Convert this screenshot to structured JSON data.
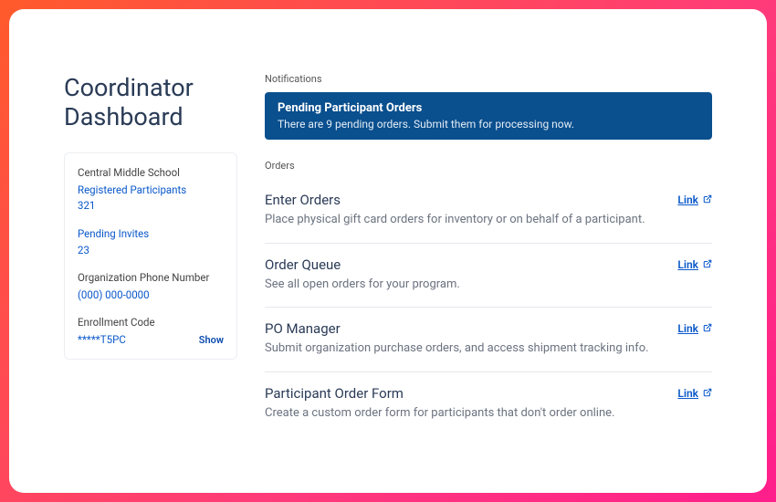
{
  "title": "Coordinator Dashboard",
  "sidebar": {
    "org_name": "Central Middle School",
    "registered_label": "Registered Participants",
    "registered_count": "321",
    "pending_invites_label": "Pending Invites",
    "pending_invites_count": "23",
    "phone_label": "Organization Phone Number",
    "phone_value": "(000) 000-0000",
    "enroll_label": "Enrollment Code",
    "enroll_value": "*****T5PC",
    "show_label": "Show"
  },
  "notifications_label": "Notifications",
  "notification": {
    "title": "Pending Participant Orders",
    "body": "There are 9 pending orders. Submit them for processing now."
  },
  "orders_label": "Orders",
  "link_label": "Link",
  "orders": [
    {
      "title": "Enter Orders",
      "desc": "Place physical gift card orders for inventory or on behalf of a participant."
    },
    {
      "title": "Order Queue",
      "desc": "See all open orders for your program."
    },
    {
      "title": "PO Manager",
      "desc": "Submit organization purchase orders, and access shipment tracking info."
    },
    {
      "title": "Participant Order Form",
      "desc": "Create a custom order form for participants that don't order online."
    }
  ]
}
